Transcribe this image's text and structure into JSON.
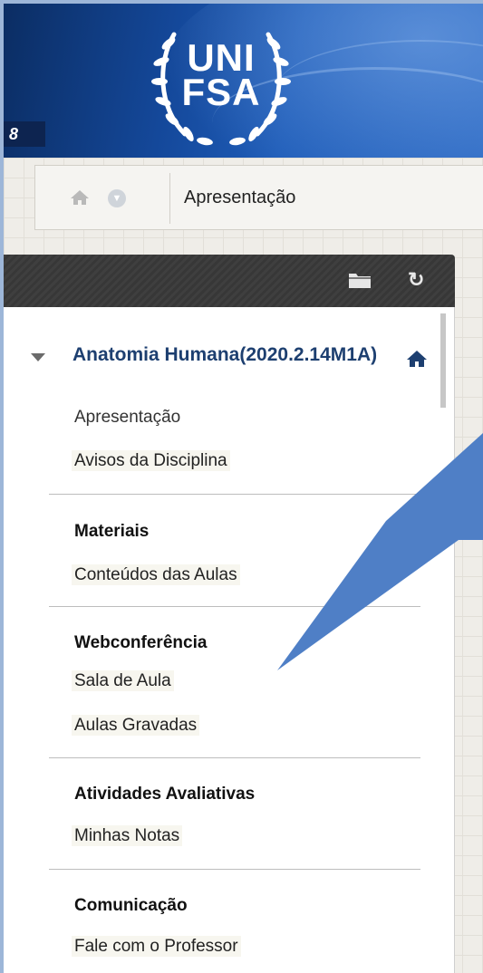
{
  "header": {
    "logo_line1": "UNI",
    "logo_line2": "FSA",
    "corner_badge": "8",
    "logo_icon": "laurel-wreath-icon"
  },
  "breadcrumb": {
    "home_icon": "home-icon",
    "dropdown_icon": "chevron-down-icon",
    "current": "Apresentação"
  },
  "panel": {
    "toolbar_icons": [
      "folder-icon",
      "refresh-icon"
    ],
    "course_title": "Anatomia Humana(2020.2.14M1A)",
    "course_home_icon": "home-icon",
    "items": {
      "apresentacao": "Apresentação",
      "avisos": "Avisos da Disciplina",
      "materiais": "Materiais",
      "conteudos": "Conteúdos das Aulas",
      "webconferencia": "Webconferência",
      "sala": "Sala de Aula",
      "gravadas": "Aulas Gravadas",
      "atividades": "Atividades Avaliativas",
      "notas": "Minhas Notas",
      "comunicacao": "Comunicação",
      "fale": "Fale com o Professor"
    }
  },
  "colors": {
    "course_title": "#1d3f70",
    "callout_arrow": "#4f7fc6",
    "page_border": "#9db6d8"
  }
}
